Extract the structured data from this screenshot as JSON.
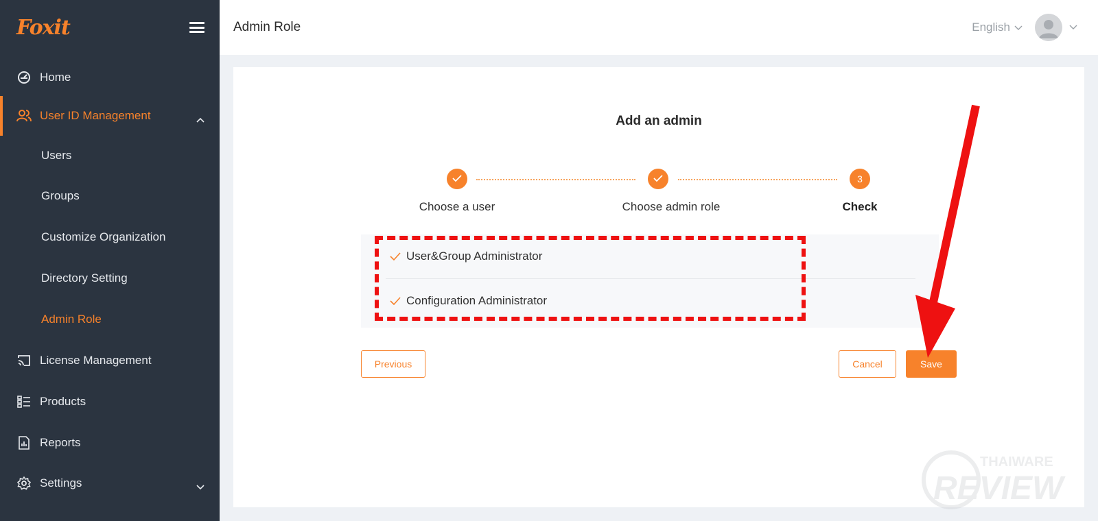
{
  "app": {
    "logo": "Foxit"
  },
  "sidebar": {
    "items": [
      {
        "label": "Home",
        "icon": "dashboard-icon"
      },
      {
        "label": "User ID Management",
        "icon": "users-icon",
        "active": true,
        "expanded": true,
        "children": [
          {
            "label": "Users"
          },
          {
            "label": "Groups"
          },
          {
            "label": "Customize Organization"
          },
          {
            "label": "Directory Setting"
          },
          {
            "label": "Admin Role",
            "active": true
          }
        ]
      },
      {
        "label": "License Management",
        "icon": "cast-icon"
      },
      {
        "label": "Products",
        "icon": "list-icon"
      },
      {
        "label": "Reports",
        "icon": "report-icon"
      },
      {
        "label": "Settings",
        "icon": "gear-icon"
      }
    ]
  },
  "header": {
    "title": "Admin Role",
    "language": "English"
  },
  "form": {
    "title": "Add an admin",
    "steps": [
      {
        "label": "Choose a user",
        "status": "done"
      },
      {
        "label": "Choose admin role",
        "status": "done"
      },
      {
        "label": "Check",
        "status": "current",
        "number": "3"
      }
    ],
    "roles": [
      "User&Group Administrator",
      "Configuration Administrator"
    ],
    "buttons": {
      "previous": "Previous",
      "cancel": "Cancel",
      "save": "Save"
    }
  },
  "watermark": {
    "line1": "THAIWARE",
    "line2": "REVIEW"
  },
  "colors": {
    "accent": "#f7822b",
    "sidebar": "#2b3440",
    "annotation": "#ee1111"
  }
}
